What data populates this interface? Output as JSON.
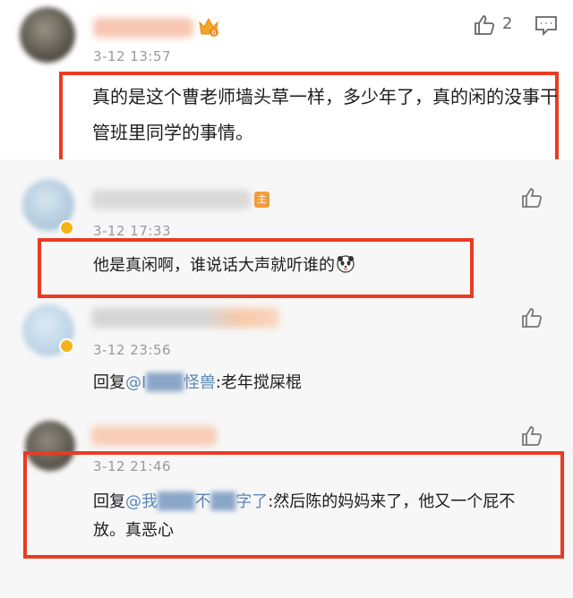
{
  "comments": [
    {
      "time": "3-12 13:57",
      "like_count": "2",
      "text": "真的是这个曹老师墙头草一样，多少年了，真的闲的没事干管班里同学的事情。",
      "icons": [
        "thumbs-up-icon",
        "reply-comment-icon",
        "crown-badge-icon"
      ]
    }
  ],
  "replies": [
    {
      "time": "3-12 17:33",
      "text": "他是真闲啊，谁说话大声就听谁的",
      "tag": "主",
      "emoji": "panda-emoji-icon"
    },
    {
      "time": "3-12 23:56",
      "reply_prefix": "回复",
      "mention_start": "@I",
      "mention_end": "怪兽",
      "text": ":老年搅屎棍"
    },
    {
      "time": "3-12 21:46",
      "reply_prefix": "回复",
      "mention_start": "@我",
      "mention_mid": "不",
      "mention_end": "字了",
      "text": ":然后陈的妈妈来了，他又一个屁不放。真恶心"
    }
  ],
  "colors": {
    "highlight_box": "#ea3b22",
    "mention": "#5b86b7",
    "background_replies": "#f7f7f7"
  }
}
